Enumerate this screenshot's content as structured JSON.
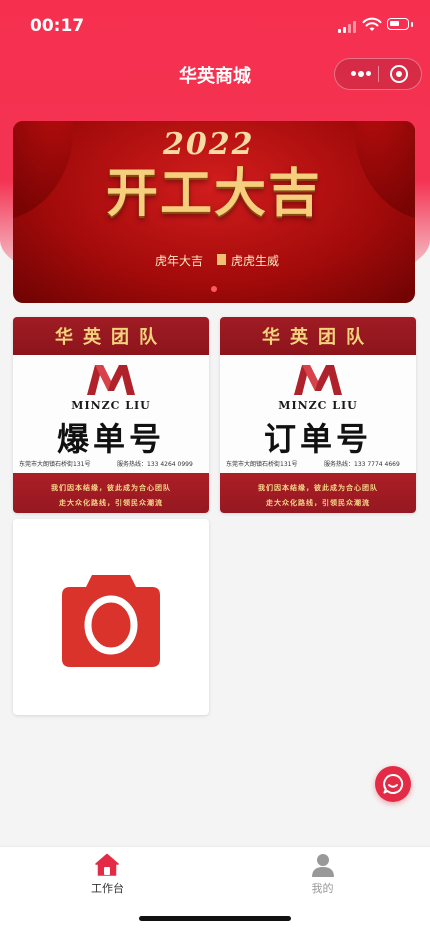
{
  "status_bar": {
    "time": "00:17"
  },
  "nav": {
    "title": "华英商城"
  },
  "banner": {
    "year": "2022",
    "slogan": "开工大吉",
    "sub_left": "虎年大吉",
    "sub_right": "虎虎生威"
  },
  "cards": [
    {
      "team": "华英团队",
      "brand": "MINZC LIU",
      "big_text": "爆单号",
      "address": "东莞市大朗镇石桥街131号",
      "hotline": "服务热线：133 4264 0999",
      "motto1": "我们因本结缘，彼此成为合心团队",
      "motto2": "走大众化路线，引领民众潮流"
    },
    {
      "team": "华英团队",
      "brand": "MINZC LIU",
      "big_text": "订单号",
      "address": "东莞市大朗镇石桥街131号",
      "hotline": "服务热线：133 7774 4669",
      "motto1": "我们因本结缘，彼此成为合心团队",
      "motto2": "走大众化路线，引领民众潮流"
    }
  ],
  "tabbar": {
    "items": [
      {
        "label": "工作台",
        "icon": "home-icon",
        "active": true
      },
      {
        "label": "我的",
        "icon": "user-icon",
        "active": false
      }
    ]
  },
  "colors": {
    "brand_red": "#f43352",
    "tab_active": "#e42b45",
    "tab_inactive": "#999999",
    "camera_red": "#d9332b"
  }
}
